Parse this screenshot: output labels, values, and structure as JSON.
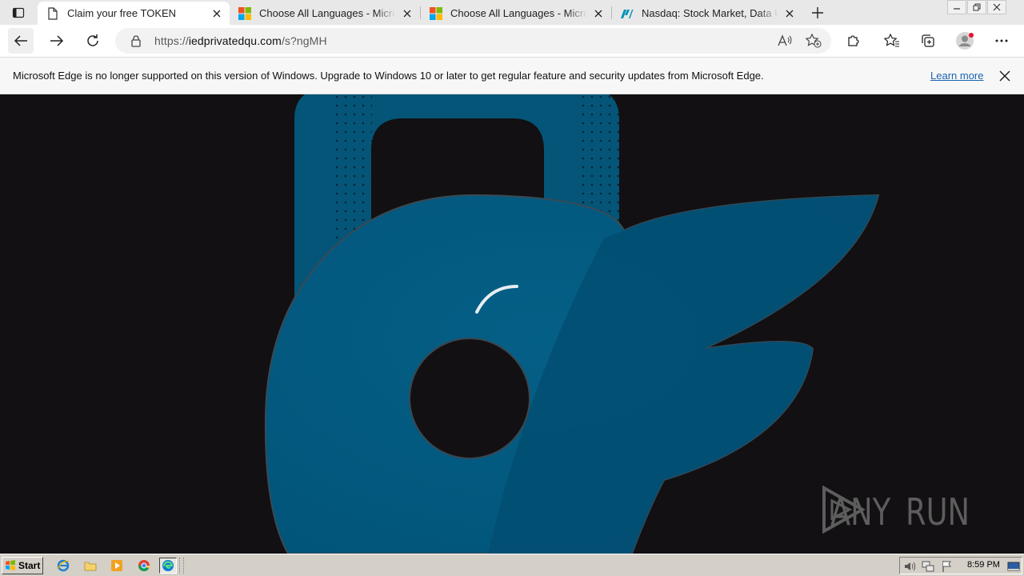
{
  "tabs": [
    {
      "title": "Claim your free TOKEN",
      "icon": "page-icon",
      "active": true
    },
    {
      "title": "Choose All Languages - Microsoft",
      "icon": "microsoft-logo-icon",
      "active": false
    },
    {
      "title": "Choose All Languages - Microsoft",
      "icon": "microsoft-logo-icon",
      "active": false
    },
    {
      "title": "Nasdaq: Stock Market, Data Updates",
      "icon": "nasdaq-logo-icon",
      "active": false
    }
  ],
  "address": {
    "prefix": "https://",
    "domain": "iedprivatedqu.com",
    "path": "/s?ngMH"
  },
  "infobar": {
    "message": "Microsoft Edge is no longer supported on this version of Windows. Upgrade to Windows 10 or later to get regular feature and security updates from Microsoft Edge.",
    "link": "Learn more"
  },
  "watermark": {
    "left": "ANY",
    "right": "RUN"
  },
  "taskbar": {
    "start_label": "Start",
    "clock": "8:59 PM"
  },
  "colors": {
    "page_background": "#121012",
    "lock_blue": "#005a84",
    "link_blue": "#1a63b3"
  }
}
